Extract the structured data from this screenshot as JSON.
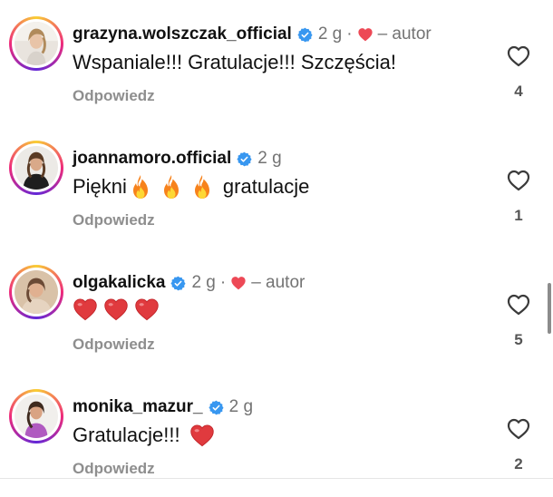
{
  "comments": [
    {
      "username": "grazyna.wolszczak_official",
      "verified": true,
      "time": "2 g",
      "dot": "·",
      "author_liked": true,
      "author_label": "– autor",
      "text": "Wspaniale!!! Gratulacje!!! Szczęścia!",
      "reply_label": "Odpowiedz",
      "likes": "4"
    },
    {
      "username": "joannamoro.official",
      "verified": true,
      "time": "2 g",
      "text_start": "Piękni",
      "emoji": "fire",
      "emoji_count": 3,
      "text_end": "gratulacje",
      "reply_label": "Odpowiedz",
      "likes": "1"
    },
    {
      "username": "olgakalicka",
      "verified": true,
      "time": "2 g",
      "dot": "·",
      "author_liked": true,
      "author_label": "– autor",
      "emoji": "red-heart",
      "emoji_count": 3,
      "reply_label": "Odpowiedz",
      "likes": "5"
    },
    {
      "username": "monika_mazur_",
      "verified": true,
      "time": "2 g",
      "text": "Gratulacje!!!",
      "emoji": "red-heart",
      "emoji_count": 1,
      "reply_label": "Odpowiedz",
      "likes": "2"
    }
  ],
  "colors": {
    "verified_badge": "#3897f0",
    "heart": "#ed4956",
    "muted_text": "#737373",
    "reply_text": "#8e8e8e"
  },
  "icons": {
    "verified": "verified-badge-icon",
    "author_heart": "red-heart-icon",
    "like": "heart-outline-icon"
  }
}
